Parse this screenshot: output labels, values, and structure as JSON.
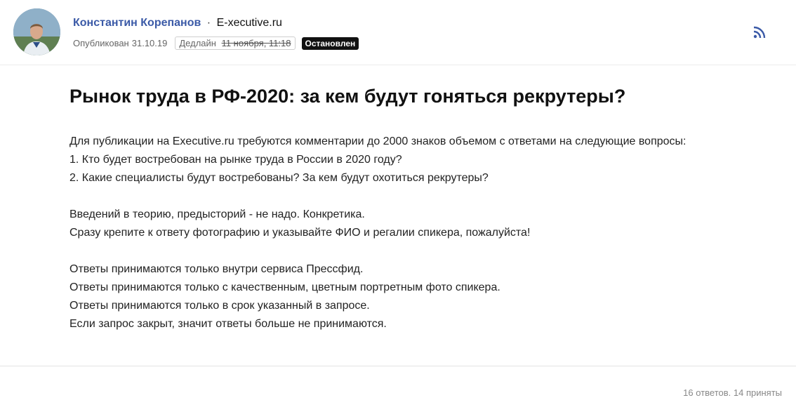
{
  "header": {
    "author_name": "Константин Корепанов",
    "separator": "·",
    "publication": "E-xecutive.ru",
    "published_label": "Опубликован",
    "published_date": "31.10.19",
    "deadline_label": "Дедлайн",
    "deadline_date": "11 ноября, 11:18",
    "status": "Остановлен",
    "rss_icon": "rss-icon"
  },
  "article": {
    "title": "Рынок труда в РФ-2020: за кем будут гоняться рекрутеры?",
    "paragraphs": [
      [
        "Для публикации на Executive.ru требуются комментарии до 2000 знаков объемом с ответами на следующие вопросы:",
        "1. Кто будет востребован на рынке труда в России в 2020 году?",
        "2. Какие специалисты будут востребованы? За кем будут охотиться рекрутеры?"
      ],
      [
        "Введений в теорию, предысторий - не надо. Конкретика.",
        "Сразу крепите к ответу фотографию и указывайте ФИО и регалии спикера, пожалуйста!"
      ],
      [
        "Ответы принимаются только внутри сервиса Прессфид.",
        "Ответы принимаются только с качественным, цветным портретным фото спикера.",
        "Ответы принимаются только в срок указанный в запросе.",
        "Если запрос закрыт, значит ответы больше не принимаются."
      ]
    ]
  },
  "footer": {
    "stats": "16 ответов. 14 приняты"
  },
  "colors": {
    "author_link": "#3b5aa7",
    "status_badge_bg": "#111111",
    "rss_icon": "#3b5aa7"
  }
}
